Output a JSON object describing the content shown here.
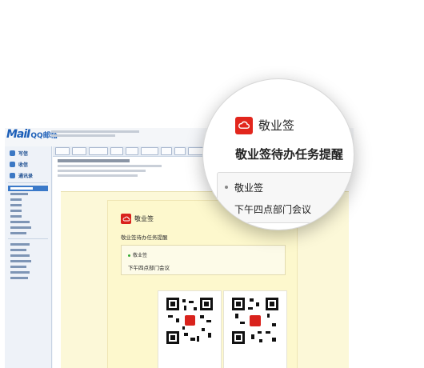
{
  "logo": {
    "mail": "MaiI",
    "suffix": "QQ邮箱"
  },
  "sidebar": {
    "buttons": [
      {
        "label": "写信",
        "icon": "pen-icon"
      },
      {
        "label": "收信",
        "icon": "inbox-icon"
      },
      {
        "label": "通讯录",
        "icon": "contacts-icon"
      }
    ]
  },
  "card": {
    "brand": "敬业签",
    "title": "敬业签待办任务提醒",
    "item_label": "敬业签",
    "item_text": "下午四点部门会议",
    "qr_left_caption": "",
    "qr_right_caption": "",
    "footer": ""
  },
  "magnifier": {
    "brand": "敬业签",
    "title": "敬业签待办任务提醒",
    "item_label": "敬业签",
    "item_text": "下午四点部门会议"
  },
  "colors": {
    "brand_red": "#e2261d",
    "mail_blue": "#1d5fb8"
  }
}
